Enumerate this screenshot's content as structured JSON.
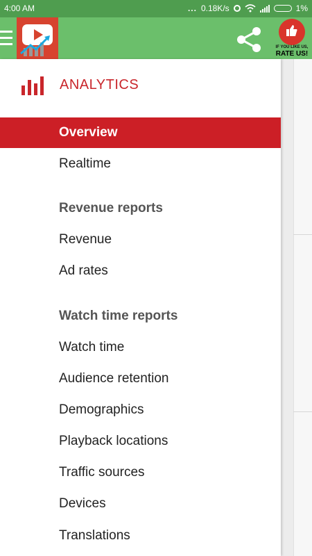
{
  "status_bar": {
    "time": "4:00 AM",
    "dots": "...",
    "speed": "0.18K/s",
    "battery": "1%"
  },
  "app_bar": {
    "rate_small": "IF YOU LIKE US,",
    "rate_big": "RATE US!"
  },
  "drawer": {
    "title": "ANALYTICS",
    "items": [
      {
        "label": "Overview",
        "type": "item",
        "active": true
      },
      {
        "label": "Realtime",
        "type": "item"
      },
      {
        "label": "Revenue reports",
        "type": "section"
      },
      {
        "label": "Revenue",
        "type": "item"
      },
      {
        "label": "Ad rates",
        "type": "item"
      },
      {
        "label": "Watch time reports",
        "type": "section"
      },
      {
        "label": "Watch time",
        "type": "item"
      },
      {
        "label": "Audience retention",
        "type": "item"
      },
      {
        "label": "Demographics",
        "type": "item"
      },
      {
        "label": "Playback locations",
        "type": "item"
      },
      {
        "label": "Traffic sources",
        "type": "item"
      },
      {
        "label": "Devices",
        "type": "item"
      },
      {
        "label": "Translations",
        "type": "item"
      }
    ]
  },
  "colors": {
    "status_bar": "#4f9d4f",
    "app_bar": "#6bbf6b",
    "accent_red": "#cc1f26"
  },
  "icons": {
    "menu": "hamburger-icon",
    "logo": "app-logo-icon",
    "share": "share-icon",
    "rate": "thumbs-up-icon",
    "analytics": "bar-chart-icon"
  }
}
